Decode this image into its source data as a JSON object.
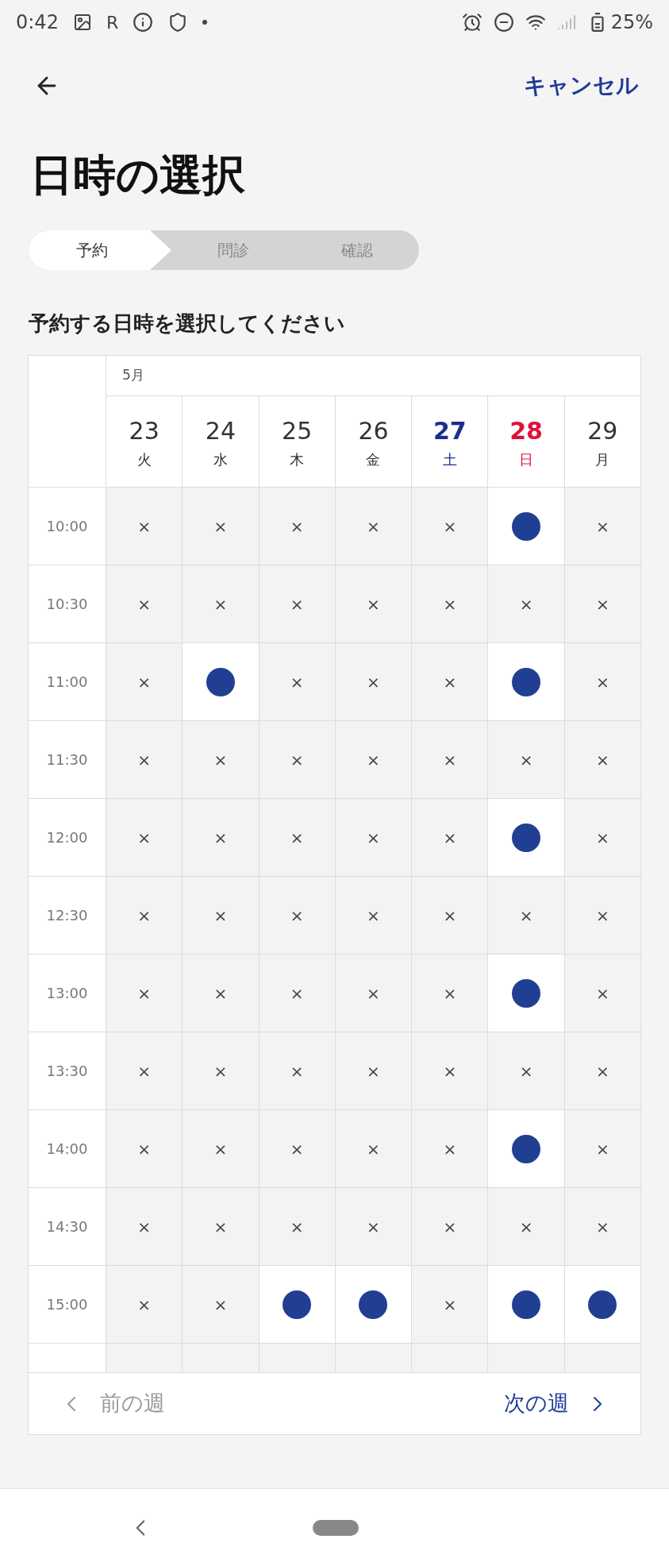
{
  "status_bar": {
    "time": "0:42",
    "letter": "R",
    "battery": "25%"
  },
  "header": {
    "cancel": "キャンセル"
  },
  "title": "日時の選択",
  "steps": [
    {
      "label": "予約",
      "selected": true
    },
    {
      "label": "問診",
      "selected": false
    },
    {
      "label": "確認",
      "selected": false
    }
  ],
  "instruction": "予約する日時を選択してください",
  "table": {
    "month": "5月",
    "days": [
      {
        "date": "23",
        "weekday": "火",
        "kind": "weekday"
      },
      {
        "date": "24",
        "weekday": "水",
        "kind": "weekday"
      },
      {
        "date": "25",
        "weekday": "木",
        "kind": "weekday"
      },
      {
        "date": "26",
        "weekday": "金",
        "kind": "weekday"
      },
      {
        "date": "27",
        "weekday": "土",
        "kind": "saturday"
      },
      {
        "date": "28",
        "weekday": "日",
        "kind": "sunday"
      },
      {
        "date": "29",
        "weekday": "月",
        "kind": "weekday"
      }
    ],
    "unavailable_mark": "×",
    "rows": [
      {
        "time": "10:00",
        "slots": [
          false,
          false,
          false,
          false,
          false,
          true,
          false
        ]
      },
      {
        "time": "10:30",
        "slots": [
          false,
          false,
          false,
          false,
          false,
          false,
          false
        ]
      },
      {
        "time": "11:00",
        "slots": [
          false,
          true,
          false,
          false,
          false,
          true,
          false
        ]
      },
      {
        "time": "11:30",
        "slots": [
          false,
          false,
          false,
          false,
          false,
          false,
          false
        ]
      },
      {
        "time": "12:00",
        "slots": [
          false,
          false,
          false,
          false,
          false,
          true,
          false
        ]
      },
      {
        "time": "12:30",
        "slots": [
          false,
          false,
          false,
          false,
          false,
          false,
          false
        ]
      },
      {
        "time": "13:00",
        "slots": [
          false,
          false,
          false,
          false,
          false,
          true,
          false
        ]
      },
      {
        "time": "13:30",
        "slots": [
          false,
          false,
          false,
          false,
          false,
          false,
          false
        ]
      },
      {
        "time": "14:00",
        "slots": [
          false,
          false,
          false,
          false,
          false,
          true,
          false
        ]
      },
      {
        "time": "14:30",
        "slots": [
          false,
          false,
          false,
          false,
          false,
          false,
          false
        ]
      },
      {
        "time": "15:00",
        "slots": [
          false,
          false,
          true,
          true,
          false,
          true,
          true
        ]
      }
    ]
  },
  "week_nav": {
    "previous": {
      "label": "前の週",
      "disabled": true
    },
    "next": {
      "label": "次の週",
      "disabled": false
    }
  }
}
